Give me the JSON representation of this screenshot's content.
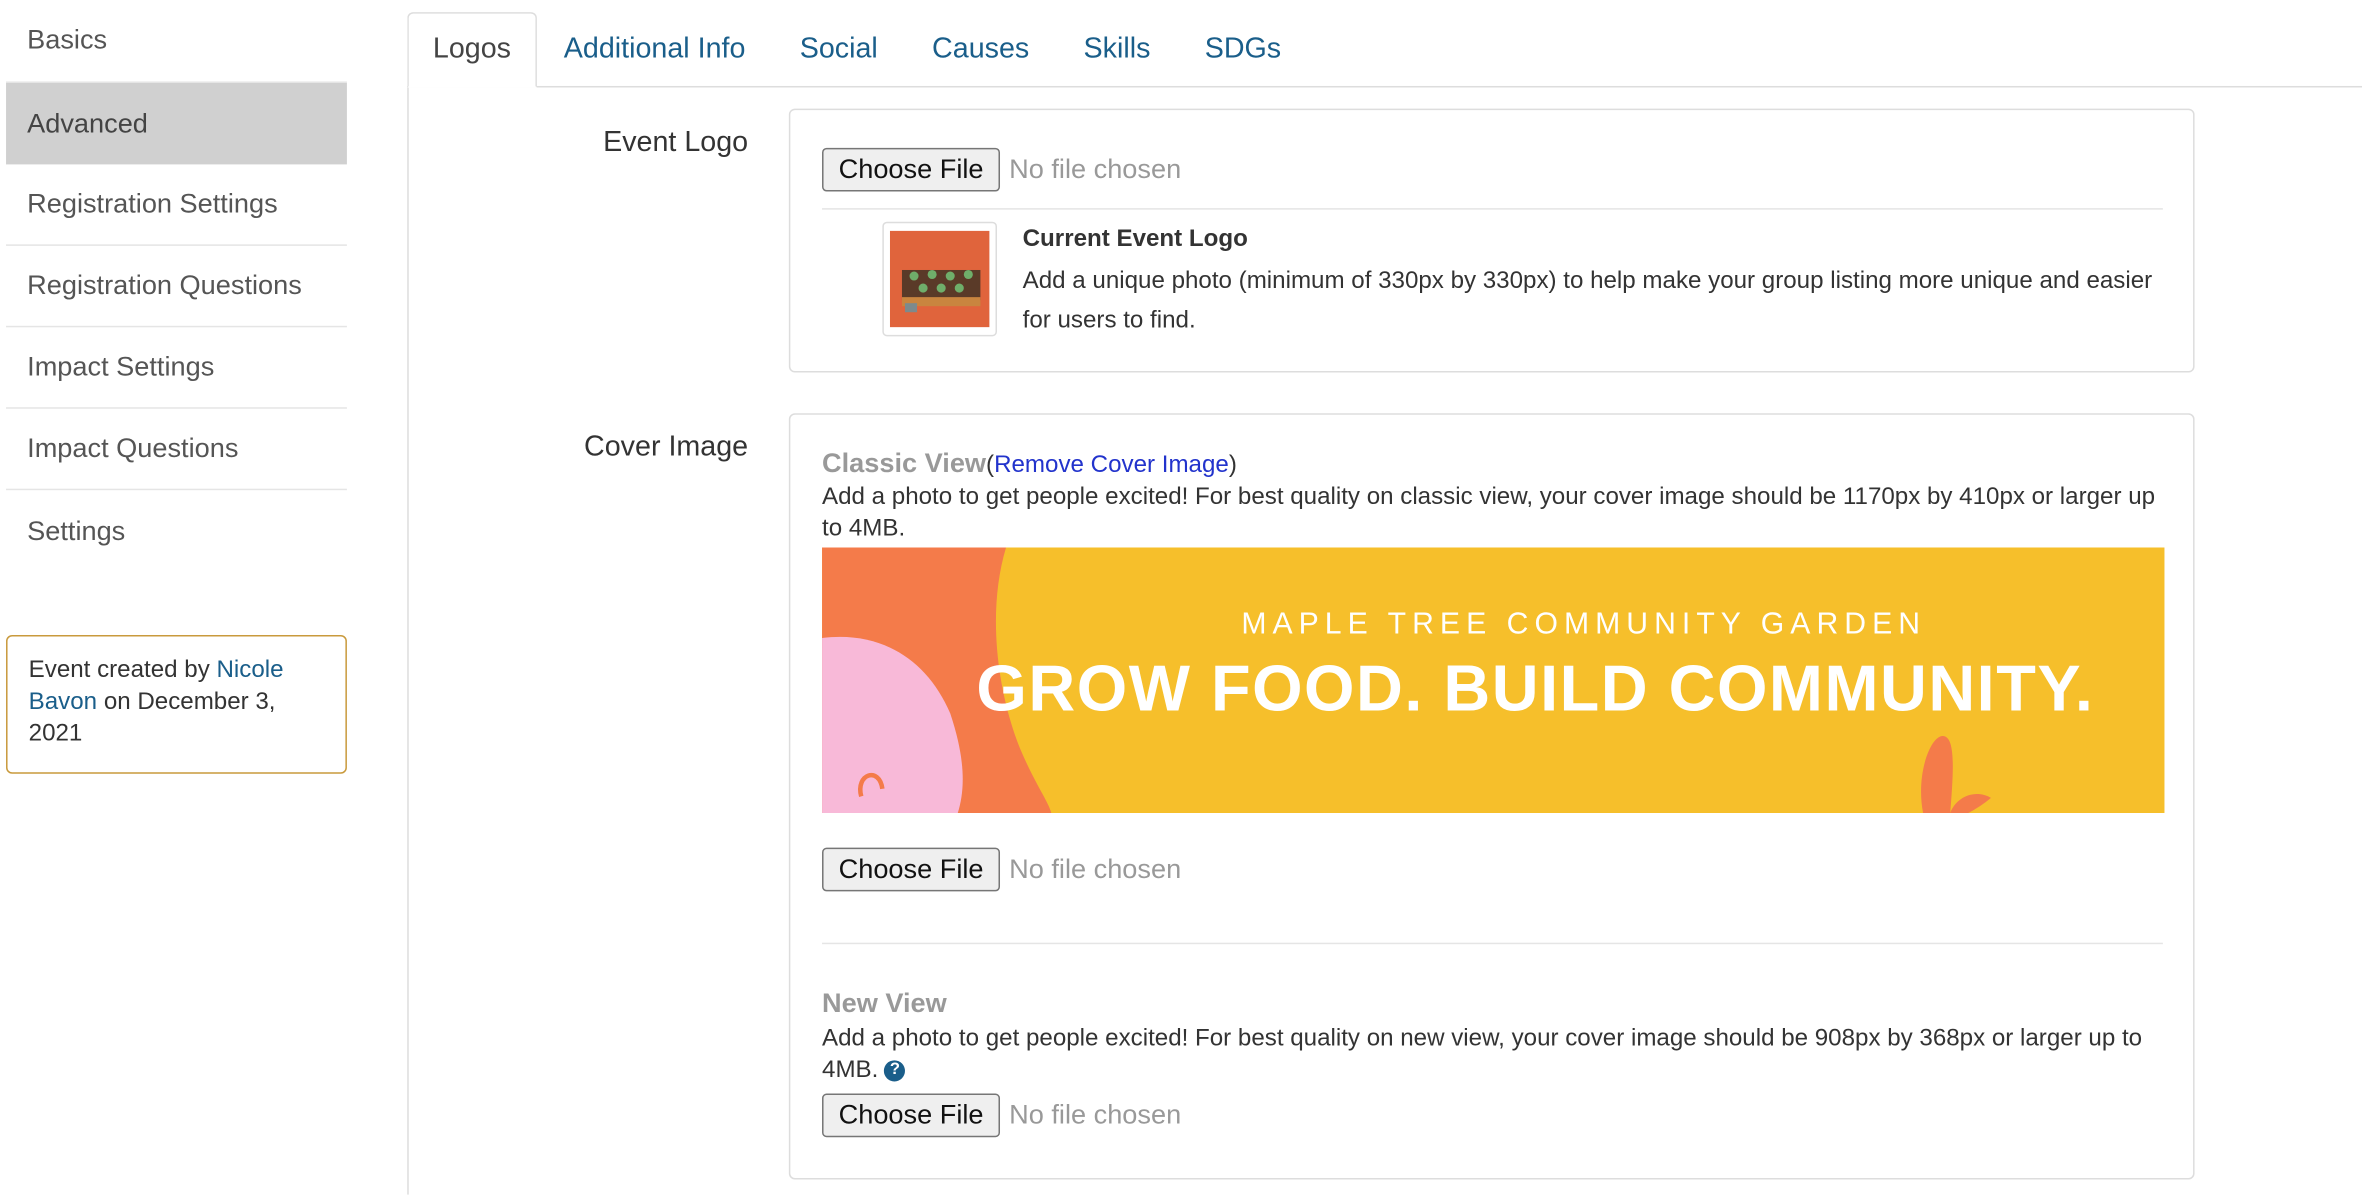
{
  "sidebar": {
    "items": [
      {
        "label": "Basics"
      },
      {
        "label": "Advanced"
      },
      {
        "label": "Registration Settings"
      },
      {
        "label": "Registration Questions"
      },
      {
        "label": "Impact Settings"
      },
      {
        "label": "Impact Questions"
      },
      {
        "label": "Settings"
      }
    ],
    "created": {
      "prefix": "Event created by",
      "author": "Nicole Bavon",
      "suffix": "on December 3, 2021"
    }
  },
  "tabs": [
    {
      "label": "Logos"
    },
    {
      "label": "Additional Info"
    },
    {
      "label": "Social"
    },
    {
      "label": "Causes"
    },
    {
      "label": "Skills"
    },
    {
      "label": "SDGs"
    }
  ],
  "event_logo": {
    "label": "Event Logo",
    "file_button": "Choose File",
    "file_status": "No file chosen",
    "current_title": "Current Event Logo",
    "current_desc": "Add a unique photo (minimum of 330px by 330px) to help make your group listing more unique and easier for users to find."
  },
  "cover_image": {
    "label": "Cover Image",
    "classic": {
      "title": "Classic View",
      "remove_link": "Remove Cover Image",
      "desc": "Add a photo to get people excited! For best quality on classic view, your cover image should be 1170px by 410px or larger up to 4MB.",
      "banner_sub": "MAPLE TREE COMMUNITY GARDEN",
      "banner_head": "GROW FOOD. BUILD COMMUNITY.",
      "file_button": "Choose File",
      "file_status": "No file chosen"
    },
    "new": {
      "title": "New View",
      "desc": "Add a photo to get people excited! For best quality on new view, your cover image should be 908px by 368px or larger up to 4MB.",
      "help_glyph": "?",
      "file_button": "Choose File",
      "file_status": "No file chosen"
    }
  },
  "colors": {
    "link": "#1a5e8a",
    "active_sidebar": "#d0d0d0",
    "created_border": "#c99a3c",
    "banner_yellow": "#f6bf2b",
    "banner_orange": "#f47b4a",
    "banner_pink": "#f8b9d8"
  }
}
